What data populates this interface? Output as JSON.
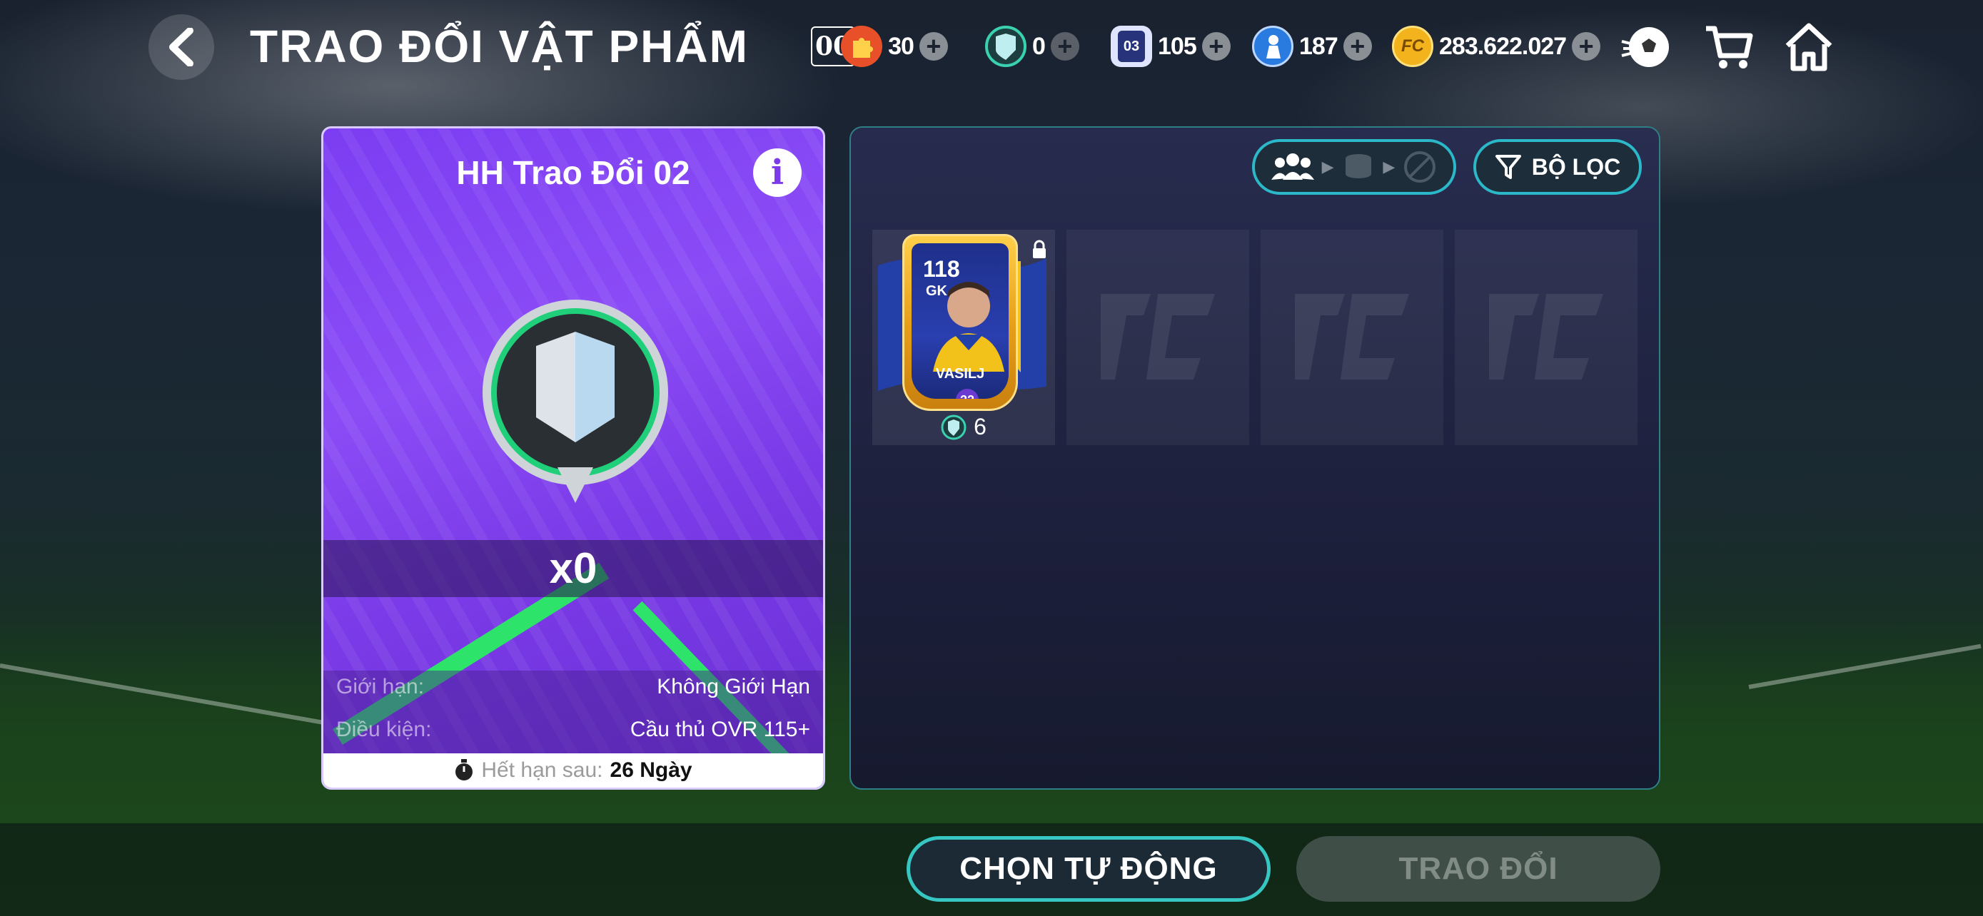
{
  "header": {
    "title": "TRAO ĐỔI VẬT PHẨM",
    "currencies": [
      {
        "name": "token",
        "value": "30",
        "color": "#e8502a",
        "prefix": "00"
      },
      {
        "name": "shield",
        "value": "0",
        "color": "#9ee7e3"
      },
      {
        "name": "card-03",
        "value": "105",
        "color": "#3a4bb0"
      },
      {
        "name": "player-token",
        "value": "187",
        "color": "#2a7be0"
      },
      {
        "name": "fc-coins",
        "value": "283.622.027",
        "color": "#f2b31c"
      }
    ]
  },
  "left_card": {
    "title": "HH Trao Đổi 02",
    "count": "x0",
    "limit_label": "Giới hạn:",
    "limit_value": "Không Giới Hạn",
    "condition_label": "Điều kiện:",
    "condition_value": "Cầu thủ OVR 115+",
    "expiry_label": "Hết hạn sau:",
    "expiry_value": "26 Ngày"
  },
  "right_panel": {
    "filter_label": "BỘ LỌC",
    "player": {
      "ovr": "118",
      "position": "GK",
      "name": "VASILJ",
      "season": "22",
      "cost": "6"
    }
  },
  "buttons": {
    "auto_label": "CHỌN TỰ ĐỘNG",
    "trade_label": "TRAO ĐỔI"
  }
}
